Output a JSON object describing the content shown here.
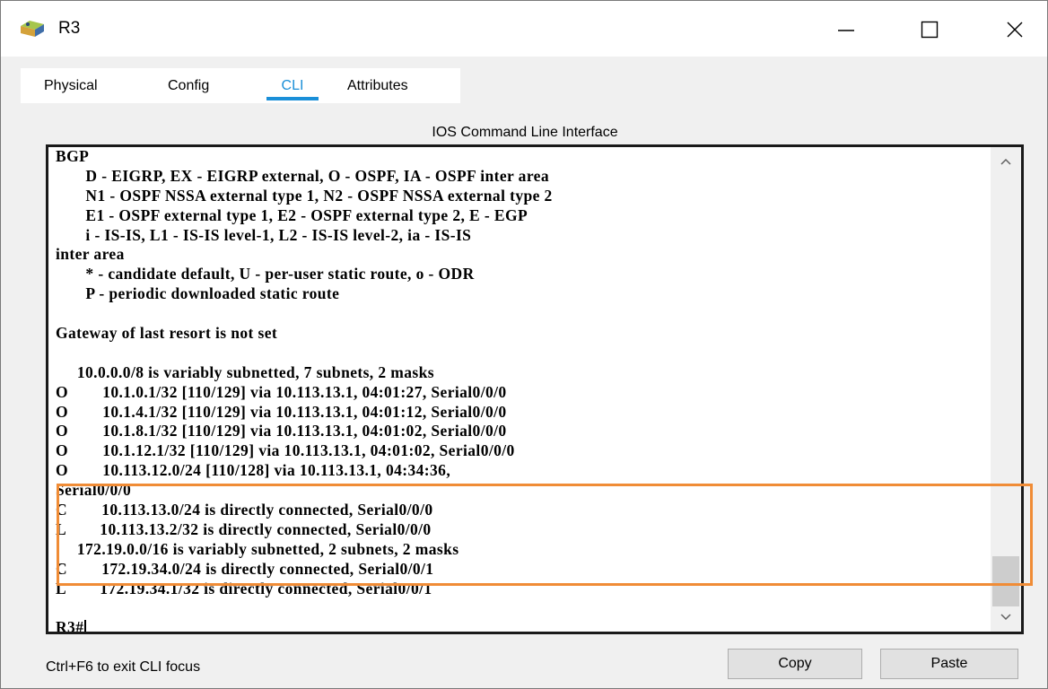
{
  "window": {
    "title": "R3",
    "app_icon": "router-icon",
    "controls": [
      "minimize-icon",
      "maximize-icon",
      "close-icon"
    ]
  },
  "tabs": [
    {
      "label": "Physical",
      "active": false
    },
    {
      "label": "Config",
      "active": false
    },
    {
      "label": "CLI",
      "active": true
    },
    {
      "label": "Attributes",
      "active": false
    }
  ],
  "panel": {
    "title": "IOS Command Line Interface"
  },
  "terminal": {
    "lines": [
      "BGP",
      "       D - EIGRP, EX - EIGRP external, O - OSPF, IA - OSPF inter area",
      "       N1 - OSPF NSSA external type 1, N2 - OSPF NSSA external type 2",
      "       E1 - OSPF external type 1, E2 - OSPF external type 2, E - EGP",
      "       i - IS-IS, L1 - IS-IS level-1, L2 - IS-IS level-2, ia - IS-IS",
      "inter area",
      "       * - candidate default, U - per-user static route, o - ODR",
      "       P - periodic downloaded static route",
      "",
      "Gateway of last resort is not set",
      "",
      "     10.0.0.0/8 is variably subnetted, 7 subnets, 2 masks",
      "O        10.1.0.1/32 [110/129] via 10.113.13.1, 04:01:27, Serial0/0/0",
      "O        10.1.4.1/32 [110/129] via 10.113.13.1, 04:01:12, Serial0/0/0",
      "O        10.1.8.1/32 [110/129] via 10.113.13.1, 04:01:02, Serial0/0/0",
      "O        10.1.12.1/32 [110/129] via 10.113.13.1, 04:01:02, Serial0/0/0",
      "O        10.113.12.0/24 [110/128] via 10.113.13.1, 04:34:36,",
      "Serial0/0/0",
      "C        10.113.13.0/24 is directly connected, Serial0/0/0",
      "L        10.113.13.2/32 is directly connected, Serial0/0/0",
      "     172.19.0.0/16 is variably subnetted, 2 subnets, 2 masks",
      "C        172.19.34.0/24 is directly connected, Serial0/0/1",
      "L        172.19.34.1/32 is directly connected, Serial0/0/1",
      ""
    ],
    "prompt": "R3#",
    "highlight_color": "#f08c36"
  },
  "footer": {
    "hint": "Ctrl+F6 to exit CLI focus",
    "copy_label": "Copy",
    "paste_label": "Paste"
  },
  "colors": {
    "accent": "#1a8fd8",
    "highlight": "#f08c36"
  }
}
